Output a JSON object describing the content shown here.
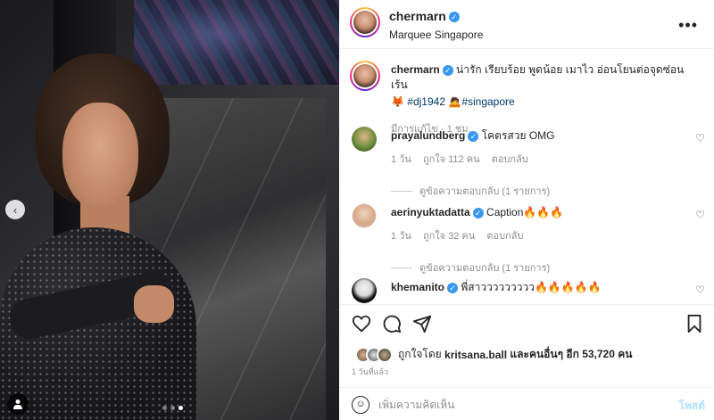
{
  "post": {
    "author": "chermarn",
    "location": "Marquee Singapore",
    "caption_line1": "น่ารัก เรียบร้อย พูดน้อย เมาไว อ่อนโยนต่อจุดซ่อนเร้น",
    "caption_tag1": "#dj1942",
    "caption_tag2": "#singapore",
    "caption_meta": "มีการแก้ไข · 1 ชม."
  },
  "comments": [
    {
      "user": "prayalundberg",
      "text": "โคตรสวย OMG",
      "time": "1 วัน",
      "likes": "ถูกใจ 112 คน",
      "reply": "ตอบกลับ",
      "view_replies": "ดูข้อความตอบกลับ (1 รายการ)"
    },
    {
      "user": "aerinyuktadatta",
      "text": "Caption🔥🔥🔥",
      "time": "1 วัน",
      "likes": "ถูกใจ 32 คน",
      "reply": "ตอบกลับ",
      "view_replies": "ดูข้อความตอบกลับ (1 รายการ)"
    },
    {
      "user": "khemanito",
      "text": "พี่สาววววววววว🔥🔥🔥🔥🔥"
    }
  ],
  "likes_summary": {
    "prefix": "ถูกใจโดย",
    "user": "kritsana.ball",
    "middle": "และคนอื่นๆ อีก",
    "count": "53,720 คน"
  },
  "post_date": "1 วันที่แล้ว",
  "comment_box": {
    "placeholder": "เพิ่มความคิดเห็น",
    "post_label": "โพสต์"
  },
  "icons": {
    "more": "more-options-icon",
    "like": "heart-icon",
    "comment": "comment-icon",
    "share": "share-icon",
    "save": "bookmark-icon",
    "emoji": "emoji-icon"
  },
  "colors": {
    "verified": "#3897f0",
    "link": "#00376b",
    "post_button": "#b2dffc"
  }
}
